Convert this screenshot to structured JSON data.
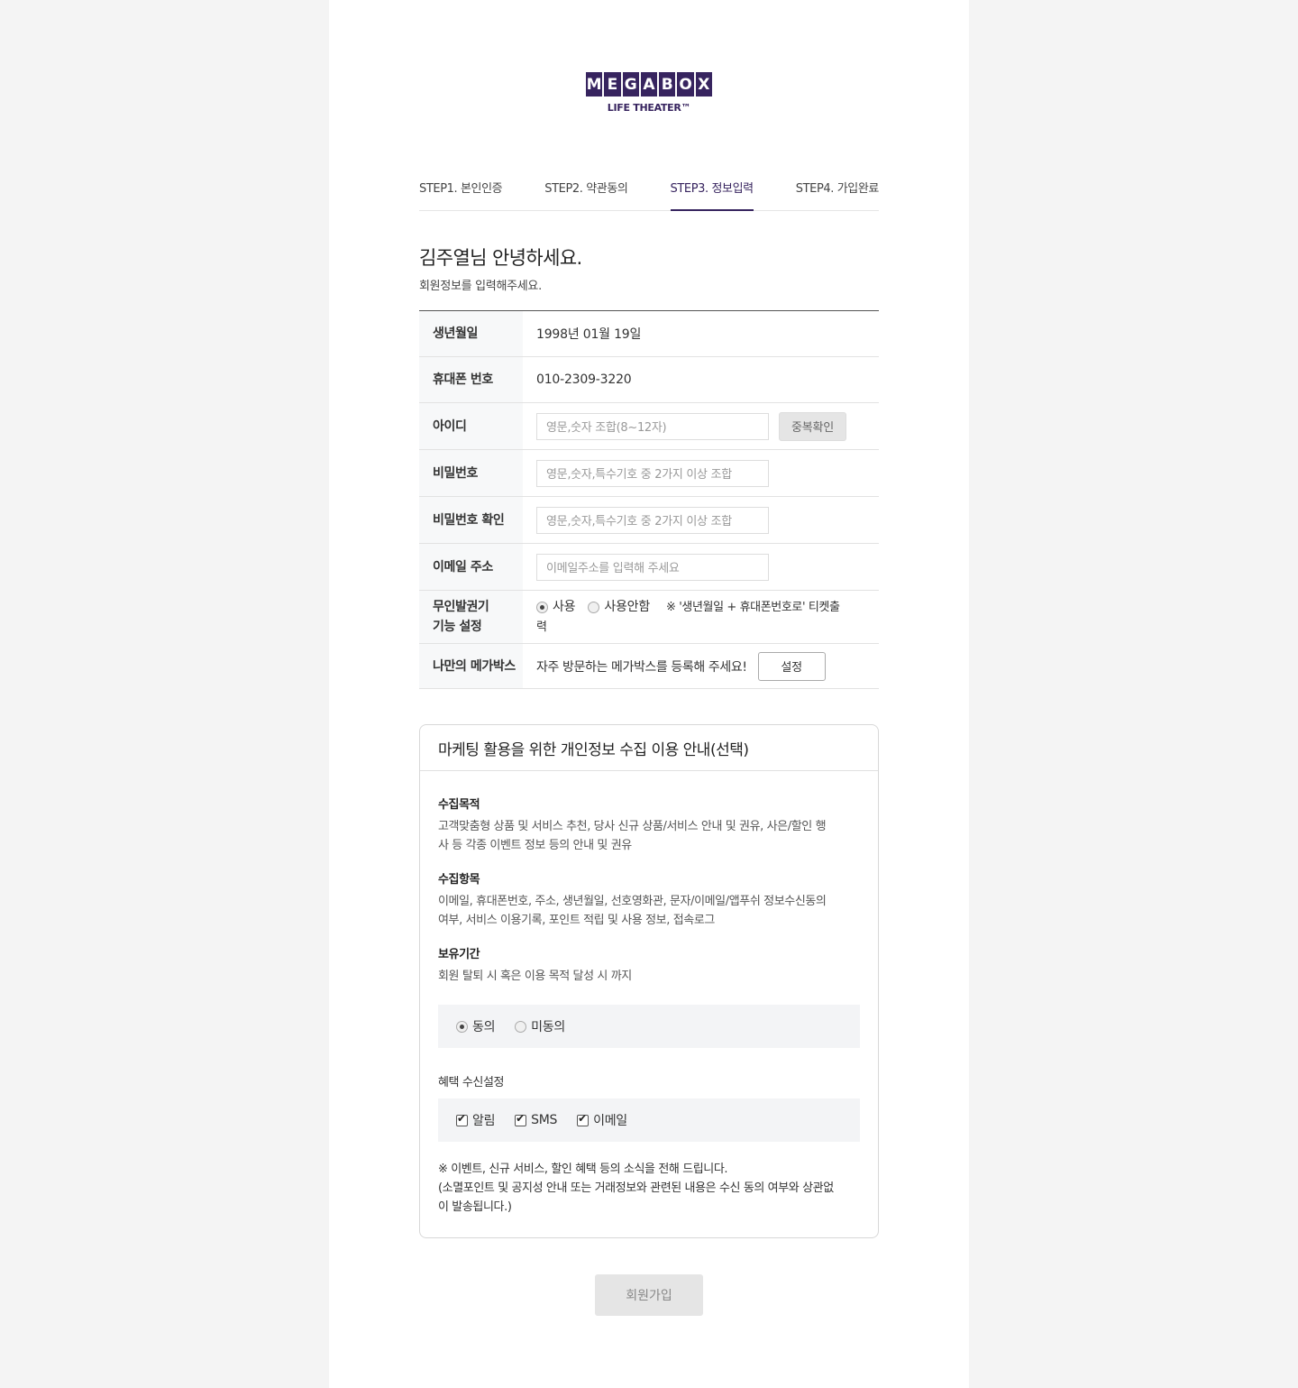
{
  "logo": {
    "letters": [
      "M",
      "E",
      "G",
      "A",
      "B",
      "O",
      "X"
    ],
    "tagline": "LIFE THEATER™",
    "color": "#37245f"
  },
  "steps": [
    {
      "label": "STEP1. 본인인증"
    },
    {
      "label": "STEP2. 약관동의"
    },
    {
      "label": "STEP3. 정보입력",
      "active": true
    },
    {
      "label": "STEP4. 가입완료"
    }
  ],
  "greeting": {
    "title": "김주열님 안녕하세요.",
    "subtitle": "회원정보를 입력해주세요."
  },
  "form": {
    "birth": {
      "label": "생년월일",
      "value": "1998년 01월 19일"
    },
    "phone": {
      "label": "휴대폰 번호",
      "value": "010-2309-3220"
    },
    "id": {
      "label": "아이디",
      "placeholder": "영문,숫자 조합(8~12자)",
      "button": "중복확인"
    },
    "password": {
      "label": "비밀번호",
      "placeholder": "영문,숫자,특수기호 중 2가지 이상 조합"
    },
    "password_confirm": {
      "label": "비밀번호 확인",
      "placeholder": "영문,숫자,특수기호 중 2가지 이상 조합"
    },
    "email": {
      "label": "이메일 주소",
      "placeholder": "이메일주소를 입력해 주세요"
    },
    "kiosk": {
      "label_line1": "무인발권기",
      "label_line2": "기능 설정",
      "option_use": "사용",
      "option_nouse": "사용안함",
      "note_line1": "※ '생년월일 + 휴대폰번호로' 티켓출",
      "note_line2": "력",
      "selected": "사용"
    },
    "my_megabox": {
      "label": "나만의 메가박스",
      "text": "자주 방문하는 메가박스를 등록해 주세요!",
      "button": "설정"
    }
  },
  "marketing": {
    "title": "마케팅 활용을 위한 개인정보 수집 이용 안내(선택)",
    "purpose_title": "수집목적",
    "purpose_line1": "고객맞춤형 상품 및 서비스 추천, 당사 신규 상품/서비스 안내 및 권유, 사은/할인 행",
    "purpose_line2": "사 등 각종 이벤트 정보 등의 안내 및 권유",
    "items_title": "수집항목",
    "items_line1": "이메일, 휴대폰번호, 주소, 생년월일, 선호영화관, 문자/이메일/앱푸쉬 정보수신동의",
    "items_line2": "여부, 서비스 이용기록, 포인트 적립 및 사용 정보, 접속로그",
    "period_title": "보유기간",
    "period_text": "회원 탈퇴 시 혹은 이용 목적 달성 시 까지",
    "agree": "동의",
    "disagree": "미동의",
    "agree_selected": "동의",
    "benefit_title": "혜택 수신설정",
    "channels": [
      {
        "label": "알림",
        "checked": true
      },
      {
        "label": "SMS",
        "checked": true
      },
      {
        "label": "이메일",
        "checked": true
      }
    ],
    "notice_line1": "※ 이벤트, 신규 서비스, 할인 혜택 등의 소식을 전해 드립니다.",
    "notice_line2": "(소멸포인트 및 공지성 안내 또는 거래정보와 관련된 내용은 수신 동의 여부와 상관없",
    "notice_line3": "이 발송됩니다.)"
  },
  "submit": {
    "label": "회원가입"
  }
}
